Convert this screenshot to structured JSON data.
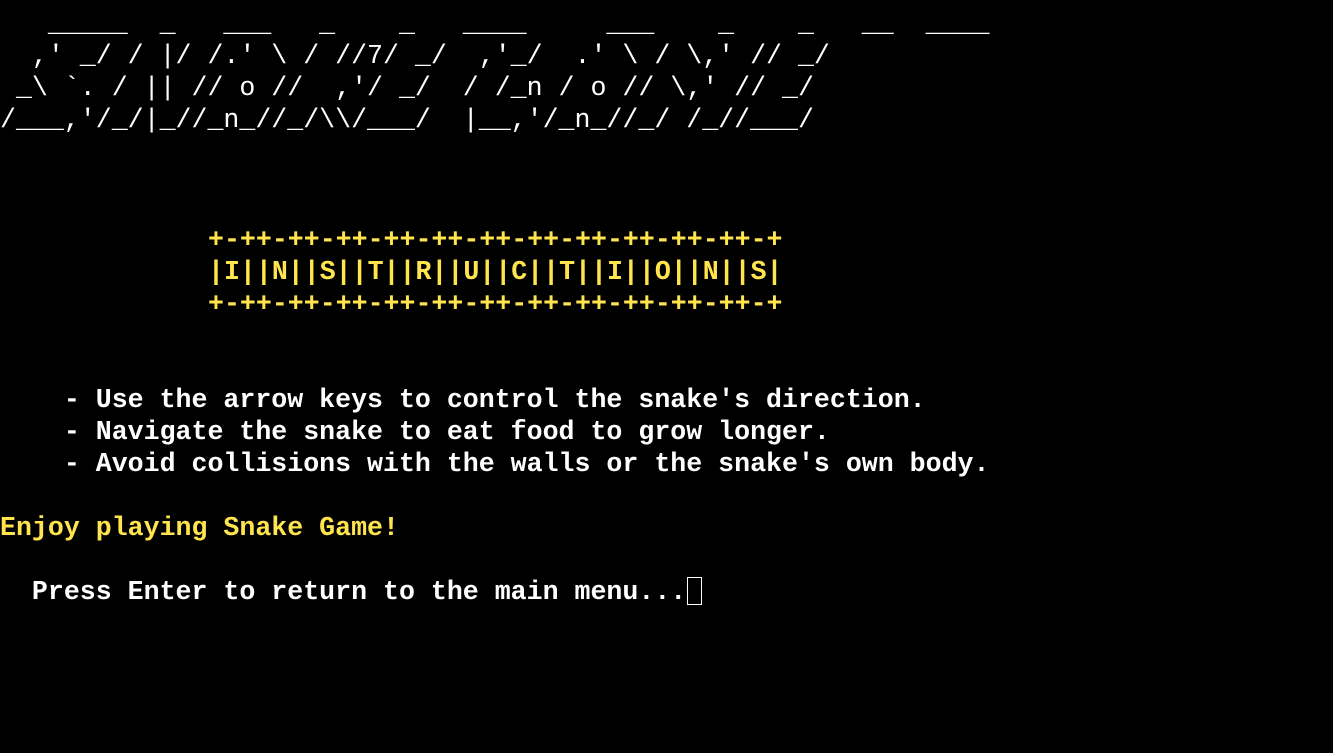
{
  "banner": {
    "lines": [
      "   _____  _   ___   _    _   ____     ___    _    _   __  ____",
      "  ,' _/ / |/ /.' \\ / //7/ _/  ,'_/  .' \\ / \\,' // _/",
      " _\\ `. / || // o //  ,'/ _/  / /_n / o // \\,' // _/",
      "/___,'/_/|_//_n_//_/\\\\/___/  |__,'/_n_//_/ /_//___/"
    ]
  },
  "instructions_header": {
    "border_top": "+-++-++-++-++-++-++-++-++-++-++-++-+",
    "title": "|I||N||S||T||R||U||C||T||I||O||N||S|",
    "border_bottom": "+-++-++-++-++-++-++-++-++-++-++-++-+"
  },
  "instructions": [
    "    - Use the arrow keys to control the snake's direction.",
    "    - Navigate the snake to eat food to grow longer.",
    "    - Avoid collisions with the walls or the snake's own body."
  ],
  "enjoy_message": "Enjoy playing Snake Game!",
  "prompt": "  Press Enter to return to the main menu...",
  "colors": {
    "background": "#000000",
    "text": "#ffffff",
    "accent": "#ffe44d"
  }
}
